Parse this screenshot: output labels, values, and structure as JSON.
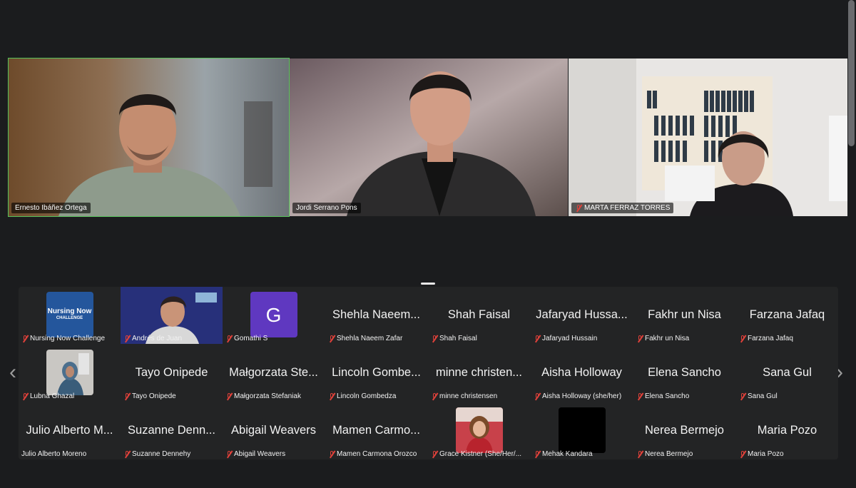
{
  "speakers": [
    {
      "name": "Ernesto Ibáñez Ortega",
      "muted": false,
      "active": true
    },
    {
      "name": "Jordi Serrano Pons",
      "muted": false,
      "active": false
    },
    {
      "name": "MARTA FERRAZ TORRES",
      "muted": true,
      "active": false
    }
  ],
  "gallery": {
    "rows": [
      [
        {
          "display": "",
          "label": "Nursing Now Challenge",
          "muted": true,
          "thumb": "nursing-now-logo",
          "logo_text_1": "Nursing Now",
          "logo_text_2": "CHALLENGE"
        },
        {
          "display": "",
          "label": "Andrés de Juan",
          "muted": true,
          "thumb": "video"
        },
        {
          "display": "",
          "label": "Gomathi S",
          "muted": true,
          "thumb": "avatar-letter",
          "avatar_letter": "G",
          "avatar_color": "#5f38c0"
        },
        {
          "display": "Shehla Naeem...",
          "label": "Shehla Naeem Zafar",
          "muted": true
        },
        {
          "display": "Shah Faisal",
          "label": "Shah Faisal",
          "muted": true
        },
        {
          "display": "Jafaryad Hussa...",
          "label": "Jafaryad Hussain",
          "muted": true
        },
        {
          "display": "Fakhr un Nisa",
          "label": "Fakhr un Nisa",
          "muted": true
        },
        {
          "display": "Farzana Jafaq",
          "label": "Farzana Jafaq",
          "muted": true
        }
      ],
      [
        {
          "display": "",
          "label": "Lubna Ghazal",
          "muted": true,
          "thumb": "photo"
        },
        {
          "display": "Tayo Onipede",
          "label": "Tayo Onipede",
          "muted": true
        },
        {
          "display": "Małgorzata Ste...",
          "label": "Małgorzata Stefaniak",
          "muted": true
        },
        {
          "display": "Lincoln Gombe...",
          "label": "Lincoln Gombedza",
          "muted": true
        },
        {
          "display": "minne christen...",
          "label": "minne christensen",
          "muted": true
        },
        {
          "display": "Aisha Holloway",
          "label": "Aisha Holloway (she/her)",
          "muted": true
        },
        {
          "display": "Elena Sancho",
          "label": "Elena Sancho",
          "muted": true
        },
        {
          "display": "Sana Gul",
          "label": "Sana Gul",
          "muted": true
        }
      ],
      [
        {
          "display": "Julio Alberto M...",
          "label": "Julio Alberto Moreno",
          "muted": false
        },
        {
          "display": "Suzanne Denn...",
          "label": "Suzanne Dennehy",
          "muted": true
        },
        {
          "display": "Abigail Weavers",
          "label": "Abigail Weavers",
          "muted": true
        },
        {
          "display": "Mamen Carmo...",
          "label": "Mamen Carmona Orozco",
          "muted": true
        },
        {
          "display": "",
          "label": "Grace Kistner (She/Her/...",
          "muted": true,
          "thumb": "photo-red"
        },
        {
          "display": "",
          "label": "Mehak Kandara",
          "muted": true,
          "thumb": "black"
        },
        {
          "display": "Nerea Bermejo",
          "label": "Nerea Bermejo",
          "muted": true
        },
        {
          "display": "Maria Pozo",
          "label": "Maria Pozo",
          "muted": true
        }
      ]
    ],
    "prev_icon": "chevron-left-icon",
    "next_icon": "chevron-right-icon",
    "prev_glyph": "‹",
    "next_glyph": "›"
  },
  "colors": {
    "active_speaker": "#57c25a",
    "muted": "#e0413a",
    "background": "#1b1c1e"
  }
}
